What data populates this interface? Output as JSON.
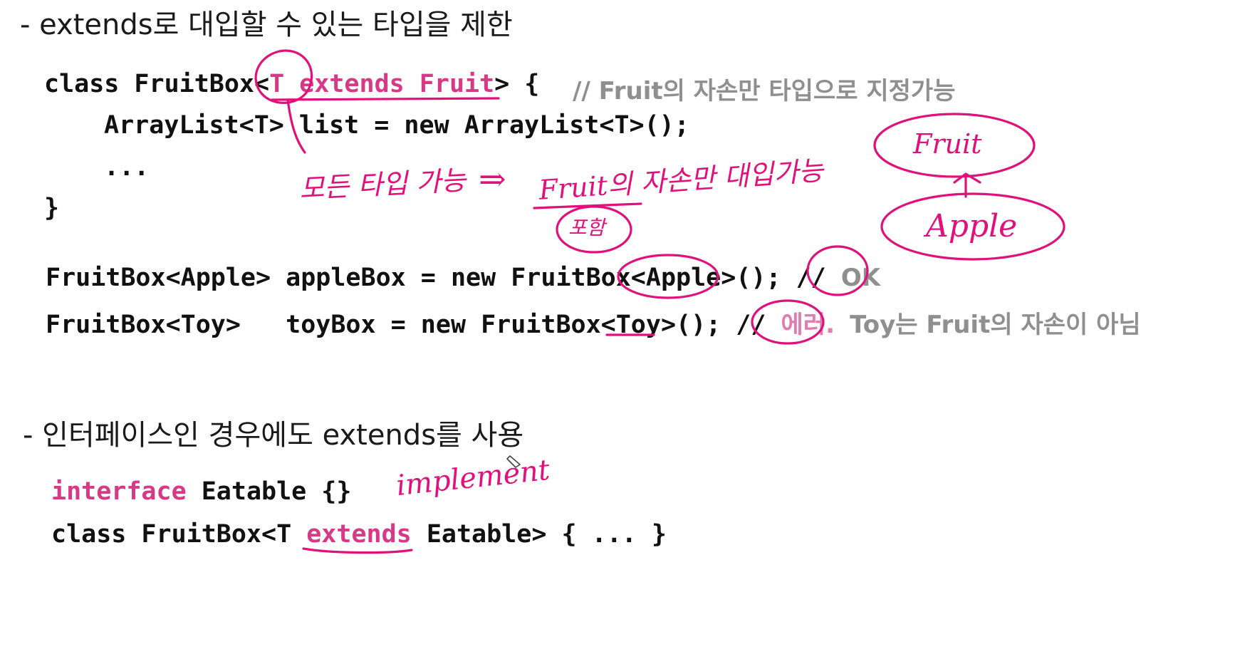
{
  "section1": {
    "heading": "- extends로 대입할 수 있는 타입을 제한",
    "code": {
      "line1_pre": "class FruitBox<",
      "line1_type": "T extends Fruit",
      "line1_post": "> {",
      "line1_comment": "// Fruit의 자손만 타입으로 지정가능",
      "line2": "ArrayList<T> list = new ArrayList<T>();",
      "line3": "...",
      "line4": "}",
      "line5_pre": "FruitBox<Apple> appleBox = new FruitBox<Apple>(); //",
      "line5_comment": "OK",
      "line6_pre": "FruitBox<Toy>   toyBox = new FruitBox<Toy>(); //",
      "line6_comment_err": "에러.",
      "line6_comment_rest": "Toy는 Fruit의 자손이 아님"
    }
  },
  "section2": {
    "heading": "- 인터페이스인 경우에도 extends를 사용",
    "code": {
      "line1_kw": "interface",
      "line1_rest": "Eatable {}",
      "line2_pre": "class FruitBox<T",
      "line2_kw": "extends",
      "line2_post": "Eatable> { ... }"
    }
  },
  "annotations": {
    "note_all_types": "모든 타입 가능",
    "arrow": "⇒",
    "note_fruit_descendants": "Fruit의 자손만 대입가능",
    "note_include": "포함",
    "diagram_parent": "Fruit",
    "diagram_child": "Apple",
    "note_implements": "implement"
  },
  "colors": {
    "ink": "#e0117a",
    "keyword": "#d63a87",
    "comment": "#8f8f8f"
  }
}
